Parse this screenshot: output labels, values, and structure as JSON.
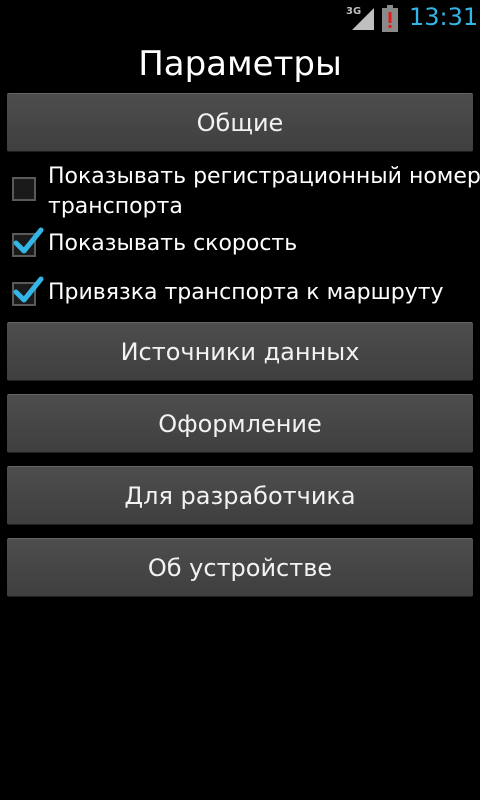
{
  "status_bar": {
    "network": "3G",
    "time": "13:31",
    "icons": [
      "signal-icon",
      "battery-alert-icon"
    ],
    "accent_color": "#33b5e5"
  },
  "title": "Параметры",
  "sections": {
    "general": "Общие",
    "data_sources": "Источники данных",
    "appearance": "Оформление",
    "developer": "Для разработчика",
    "about_device": "Об устройстве"
  },
  "options": [
    {
      "label_line1": "Показывать регистрационный номер",
      "label_line2": "транспорта",
      "checked": false
    },
    {
      "label": "Показывать скорость",
      "checked": true
    },
    {
      "label": "Привязка транспорта к маршруту",
      "checked": true
    }
  ]
}
